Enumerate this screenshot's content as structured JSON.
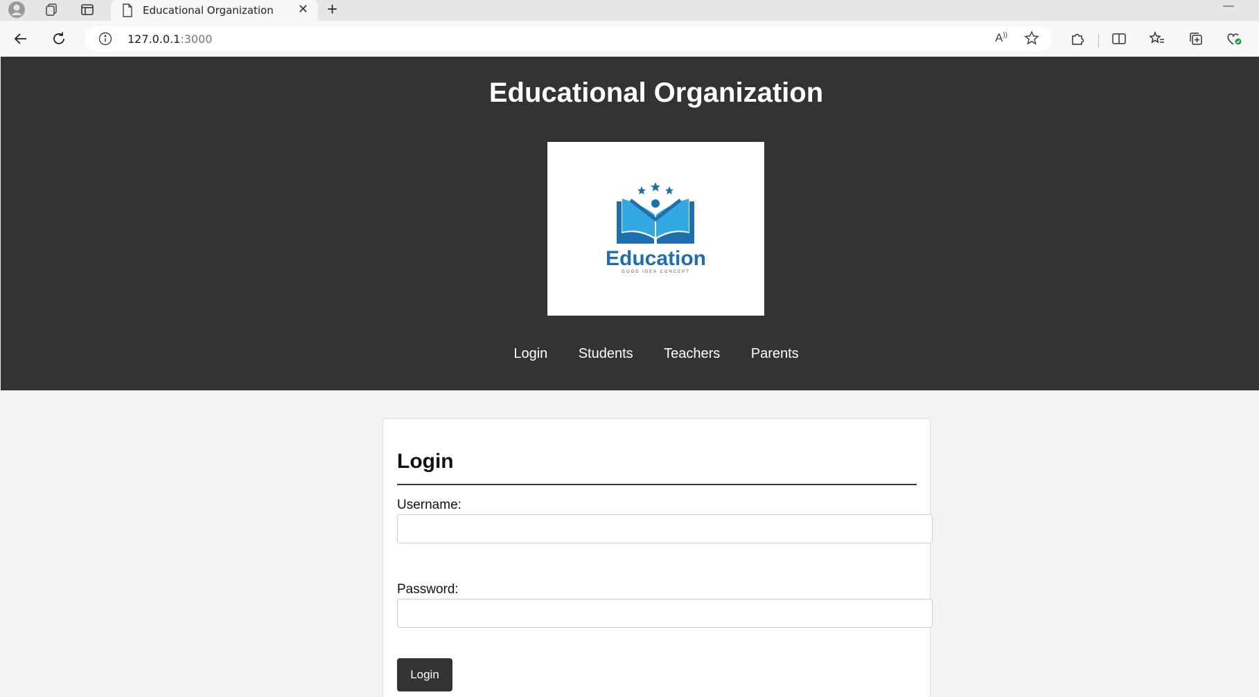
{
  "browser": {
    "tab_title": "Educational Organization",
    "url_host": "127.0.0.1",
    "url_port": ":3000"
  },
  "site": {
    "title": "Educational Organization",
    "logo_text": "Education",
    "logo_tagline": "GOOD IDEA CONCEPT",
    "nav": [
      {
        "label": "Login"
      },
      {
        "label": "Students"
      },
      {
        "label": "Teachers"
      },
      {
        "label": "Parents"
      }
    ]
  },
  "login": {
    "heading": "Login",
    "username_label": "Username:",
    "username_value": "",
    "password_label": "Password:",
    "password_value": "",
    "submit_label": "Login"
  },
  "colors": {
    "header_bg": "#333333",
    "page_bg": "#f3f3f3",
    "logo_blue": "#1e6fb0",
    "logo_light_blue": "#34a8e0"
  }
}
